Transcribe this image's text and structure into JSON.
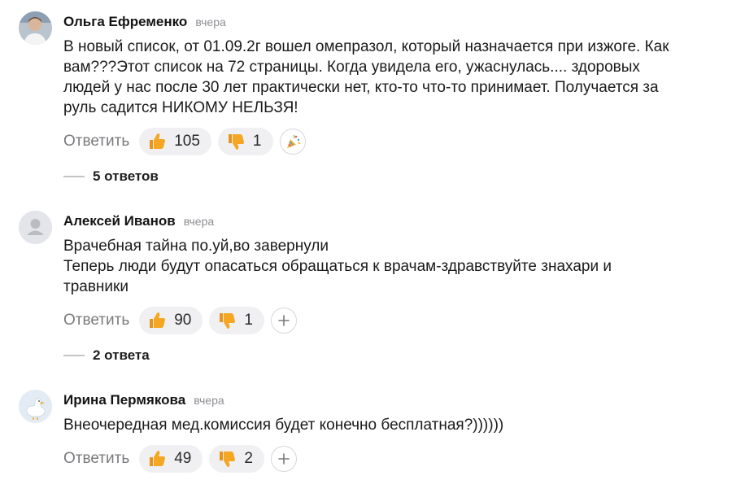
{
  "comments": [
    {
      "author": "Ольга Ефременко",
      "time": "вчера",
      "avatar_icon": "photo-avatar-icon",
      "lines": [
        "В новый список, от 01.09.2г вошел омепразол, который назначается при изжоге. Как",
        "вам???Этот список на 72 страницы. Когда увидела его, ужаснулась.... здоровых",
        "людей у нас после 30 лет практически нет, кто-то что-то принимает. Получается за",
        "руль садится НИКОМУ НЕЛЬЗЯ!"
      ],
      "reply_label": "Ответить",
      "likes": "105",
      "dislikes": "1",
      "extra_reaction_icon": "party-popper-icon",
      "replies_label": "5 ответов"
    },
    {
      "author": "Алексей Иванов",
      "time": "вчера",
      "avatar_icon": "default-user-avatar-icon",
      "lines": [
        "Врачебная тайна по.уй,во завернули",
        "Теперь люди будут опасаться обращаться к врачам-здравствуйте знахари и",
        "травники"
      ],
      "reply_label": "Ответить",
      "likes": "90",
      "dislikes": "1",
      "extra_reaction_icon": "plus-icon",
      "replies_label": "2 ответа"
    },
    {
      "author": "Ирина Пермякова",
      "time": "вчера",
      "avatar_icon": "goose-avatar-icon",
      "lines": [
        "Внеочередная мед.комиссия будет конечно бесплатная?))))))"
      ],
      "reply_label": "Ответить",
      "likes": "49",
      "dislikes": "2",
      "extra_reaction_icon": "plus-icon"
    }
  ],
  "colors": {
    "pill_bg": "#f0f0f2",
    "thumb": "#f5a623",
    "secondary_text": "#7a7a7e"
  }
}
